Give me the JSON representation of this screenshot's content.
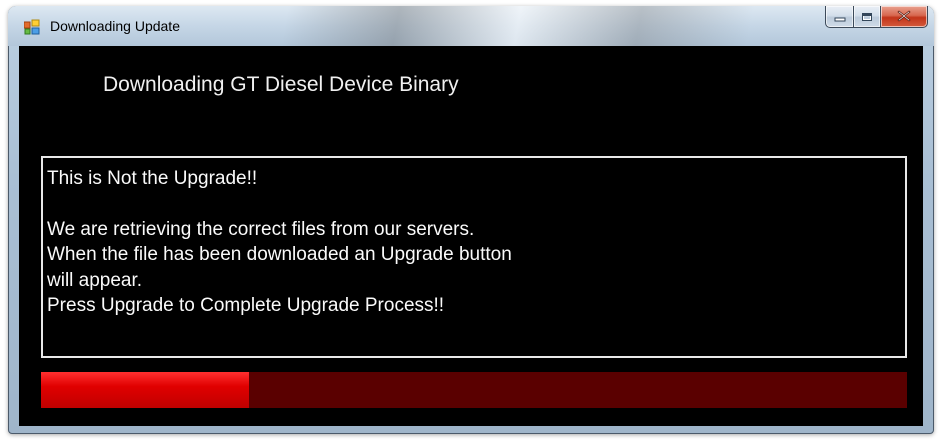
{
  "window": {
    "title": "Downloading Update",
    "icon": "windows-form-icon"
  },
  "caption_buttons": {
    "minimize_icon": "minimize-icon",
    "maximize_icon": "maximize-icon",
    "close_icon": "close-icon"
  },
  "main": {
    "heading": "Downloading GT Diesel Device Binary",
    "message_lines": [
      "This is Not the Upgrade!!",
      "",
      "We are retrieving the correct files from our servers.",
      "When the file has been downloaded an Upgrade button",
      "will appear.",
      "Press Upgrade to Complete Upgrade Process!!"
    ],
    "progress": {
      "value_fraction": 0.24,
      "fill_color": "#e00000",
      "track_color": "#5a0000"
    }
  },
  "colors": {
    "client_background": "#000000",
    "text": "#ffffff"
  }
}
